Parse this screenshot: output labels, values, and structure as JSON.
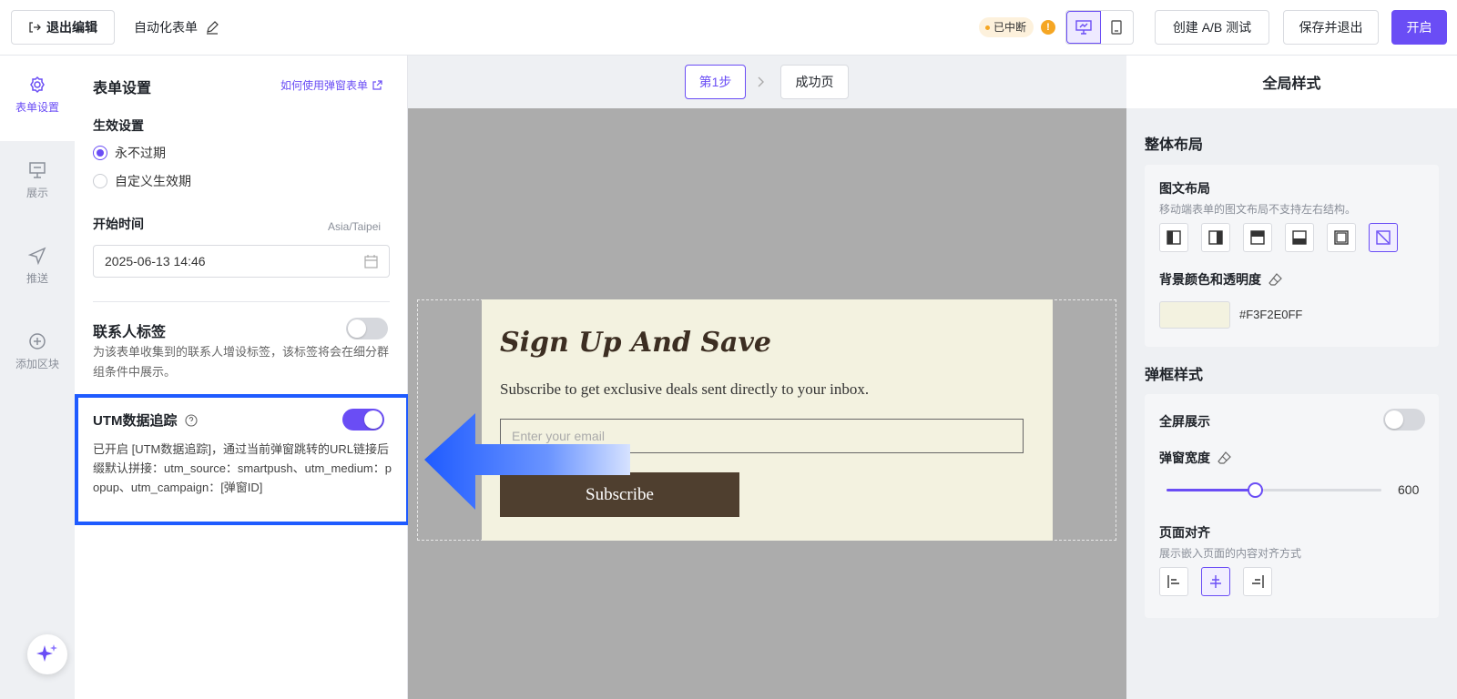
{
  "topbar": {
    "exit_edit": "退出编辑",
    "form_title": "自动化表单",
    "status_badge": "已中断",
    "ab_test": "创建 A/B 测试",
    "save_exit": "保存并退出",
    "open": "开启"
  },
  "rail": {
    "items": [
      {
        "label": "表单设置",
        "icon": "gear-icon"
      },
      {
        "label": "展示",
        "icon": "display-icon"
      },
      {
        "label": "推送",
        "icon": "send-icon"
      },
      {
        "label": "添加区块",
        "icon": "plus-circle-icon"
      }
    ]
  },
  "panel": {
    "title": "表单设置",
    "help_link": "如何使用弹窗表单",
    "validity_label": "生效设置",
    "option_never": "永不过期",
    "option_custom": "自定义生效期",
    "selected_option": "永不过期",
    "start_time_label": "开始时间",
    "timezone": "Asia/Taipei",
    "start_time_value": "2025-06-13 14:46",
    "contact_tag_label": "联系人标签",
    "contact_tag_on": false,
    "contact_tag_desc": "为该表单收集到的联系人增设标签，该标签将会在细分群组条件中展示。",
    "utm_label": "UTM数据追踪",
    "utm_on": true,
    "utm_desc": "已开启 [UTM数据追踪]，通过当前弹窗跳转的URL链接后缀默认拼接：utm_source：smartpush、utm_medium：popup、utm_campaign：[弹窗ID]"
  },
  "canvas": {
    "step1": "第1步",
    "success": "成功页",
    "popup": {
      "headline": "Sign Up And Save",
      "subtext": "Subscribe to get exclusive deals sent directly to your inbox.",
      "email_placeholder": "Enter your email",
      "button": "Subscribe",
      "bg_color": "#F3F2E0",
      "button_color": "#4F3F2F"
    }
  },
  "right": {
    "title": "全局样式",
    "layout_section": "整体布局",
    "image_text_layout": "图文布局",
    "layout_hint": "移动端表单的图文布局不支持左右结构。",
    "bg_label": "背景颜色和透明度",
    "bg_hex": "#F3F2E0FF",
    "popup_section": "弹框样式",
    "fullscreen_label": "全屏展示",
    "fullscreen_on": false,
    "width_label": "弹窗宽度",
    "width_value": "600",
    "width_fraction": 0.41,
    "align_label": "页面对齐",
    "align_hint": "展示嵌入页面的内容对齐方式",
    "selected_align": "center"
  },
  "colors": {
    "accent": "#6A4DF5",
    "highlight_border": "#1F5BFF",
    "status_badge_bg": "#FDF1DC"
  }
}
